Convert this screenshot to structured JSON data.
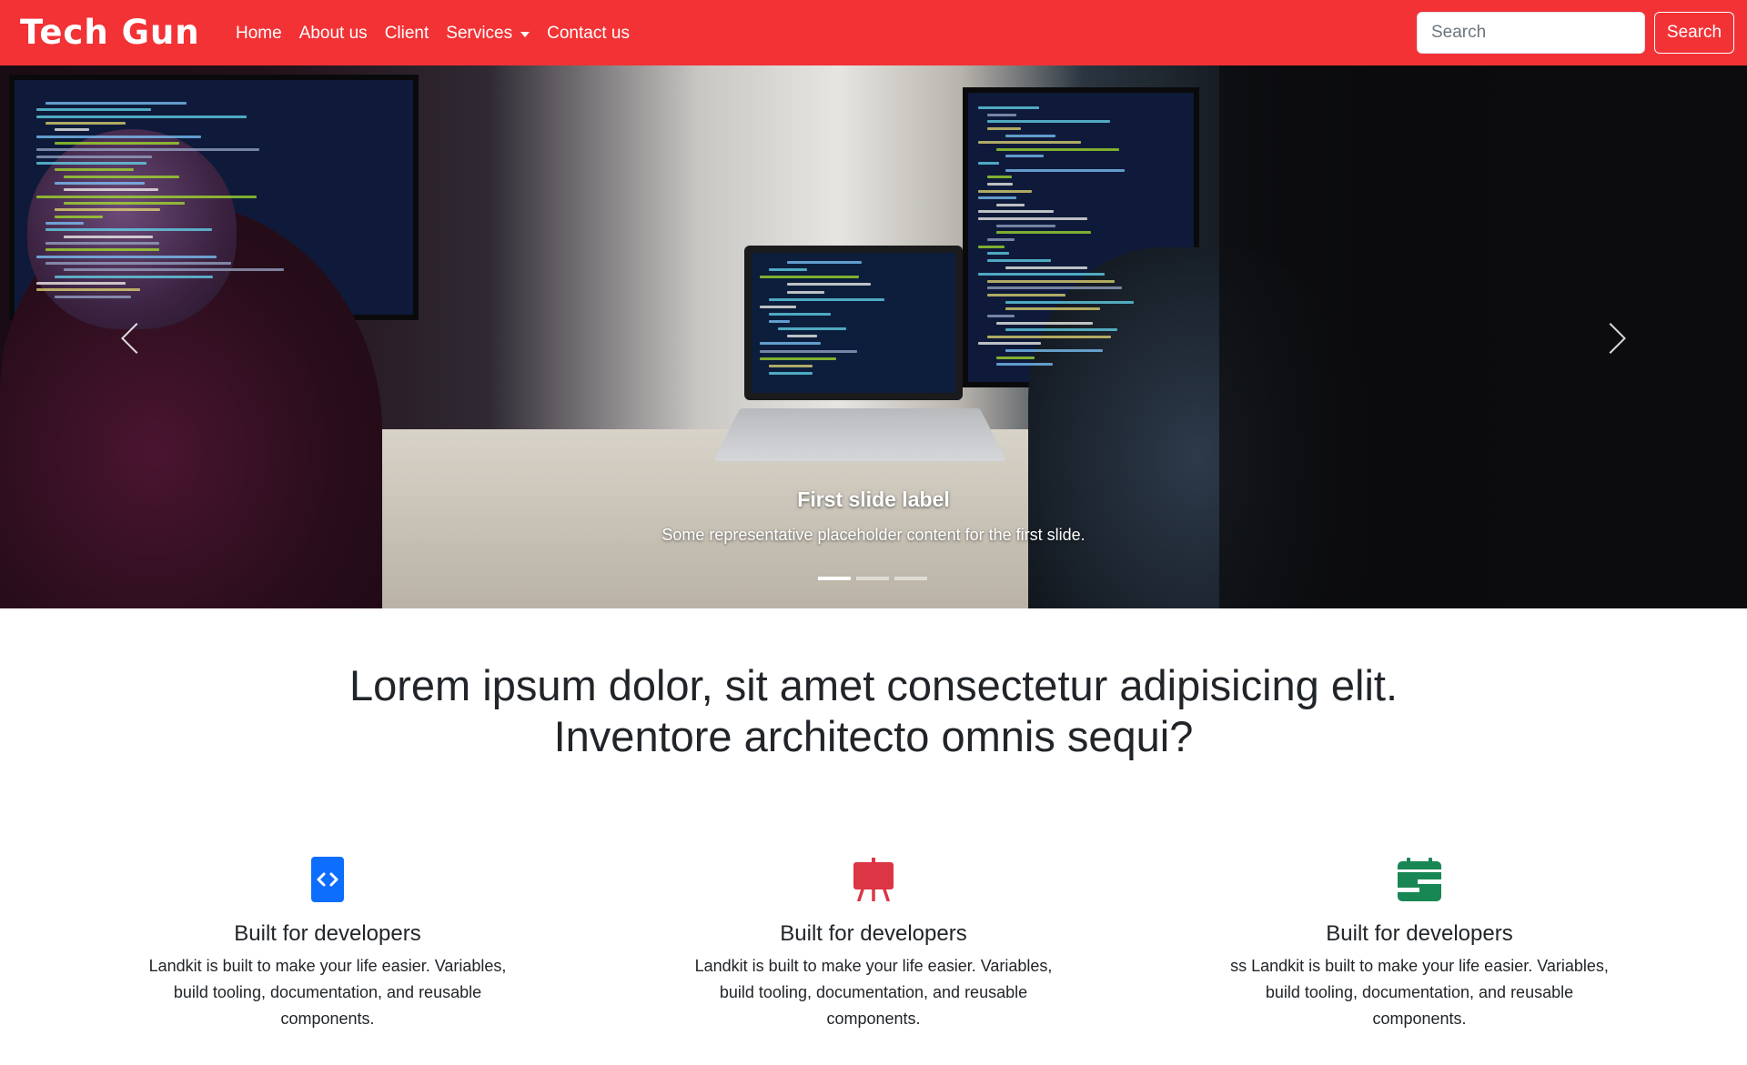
{
  "navbar": {
    "brand": "Tech Gun",
    "links": [
      "Home",
      "About us",
      "Client",
      "Services",
      "Contact us"
    ],
    "search_placeholder": "Search",
    "search_button": "Search",
    "background": "#f23235"
  },
  "carousel": {
    "caption_title": "First slide label",
    "caption_text": "Some representative placeholder content for the first slide.",
    "indicator_count": 3,
    "active_indicator": 1
  },
  "headline": {
    "line1": "Lorem ipsum dolor, sit amet consectetur adipisicing elit.",
    "line2": "Inventore architecto omnis sequi?"
  },
  "features": [
    {
      "icon": "code-icon",
      "icon_color": "#0d6efd",
      "title": "Built for developers",
      "text": "Landkit is built to make your life easier. Variables, build tooling, documentation, and reusable components."
    },
    {
      "icon": "easel-icon",
      "icon_color": "#dc3545",
      "title": "Built for developers",
      "text": "Landkit is built to make your life easier. Variables, build tooling, documentation, and reusable components."
    },
    {
      "icon": "calendar-icon",
      "icon_color": "#198754",
      "title": "Built for developers",
      "text": "ss Landkit is built to make your life easier. Variables, build tooling, documentation, and reusable components."
    }
  ]
}
